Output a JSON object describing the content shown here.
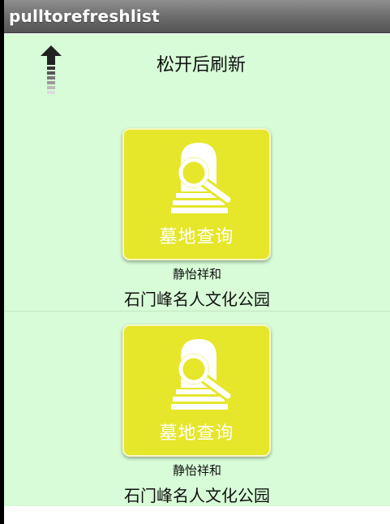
{
  "app": {
    "title": "pulltorefreshlist"
  },
  "refresh_header": {
    "text": "松开后刷新",
    "icon": "arrow-up-icon"
  },
  "items": [
    {
      "tile_label": "墓地查询",
      "subtitle": "静怡祥和",
      "title": "石门峰名人文化公园",
      "icon": "tombstone-search-icon"
    },
    {
      "tile_label": "墓地查询",
      "subtitle": "静怡祥和",
      "title": "石门峰名人文化公园",
      "icon": "tombstone-search-icon"
    }
  ],
  "colors": {
    "list_background": "#d7fcd7",
    "tile": "#e6e62b",
    "title_bar": "#6a6a6a"
  }
}
